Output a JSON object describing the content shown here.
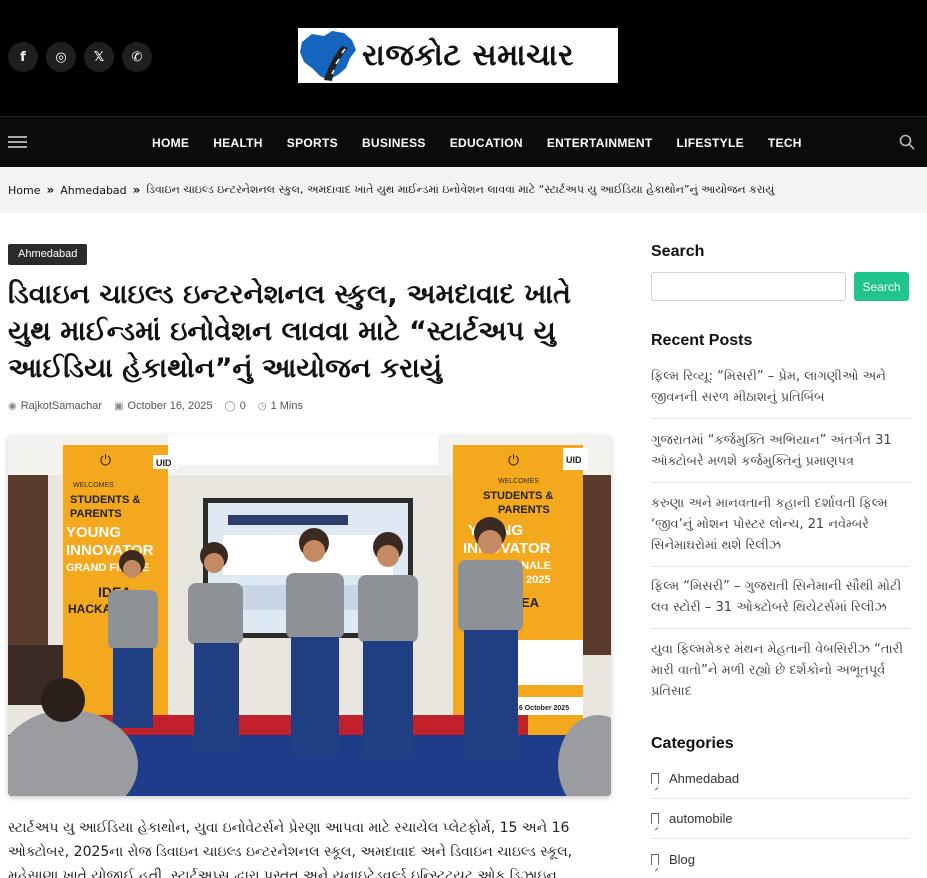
{
  "header": {
    "socials": [
      {
        "icon": "facebook-icon",
        "glyph": "f"
      },
      {
        "icon": "instagram-icon",
        "glyph": "◎"
      },
      {
        "icon": "x-icon",
        "glyph": "𝕏"
      },
      {
        "icon": "whatsapp-icon",
        "glyph": "✆"
      }
    ],
    "logo_text": "રાજકોટ સમાચાર"
  },
  "nav": {
    "items": [
      "HOME",
      "HEALTH",
      "SPORTS",
      "BUSINESS",
      "EDUCATION",
      "ENTERTAINMENT",
      "LIFESTYLE",
      "TECH"
    ]
  },
  "breadcrumb": {
    "home": "Home",
    "category": "Ahmedabad",
    "current": "ડિવાઇન ચાઇલ્ડ ઇન્ટરનેશનલ સ્કુલ, અમદાવાદ ખાતે યુથ માઈન્ડમાં ઇનોવેશન લાવવા માટે “સ્ટાર્ટઅપ યુ આઈડિયા હેકાથોન”નું આયોજન કરાયું"
  },
  "article": {
    "category": "Ahmedabad",
    "title": "ડિવાઇન ચાઇલ્ડ ઇન્ટરનેશનલ સ્કુલ, અમદાવાદ ખાતે યુથ માઈન્ડમાં ઇનોવેશન લાવવા માટે “સ્ટાર્ટઅપ યુ આઈડિયા હેકાથોન”નું આયોજન કરાયું",
    "author": "RajkotSamachar",
    "date": "October 16, 2025",
    "comments": "0",
    "read_time": "1 Mins",
    "body": "સ્ટાર્ટઅપ યુ આઈડિયા હેકાથોન, યુવા ઇનોવેટર્સને પ્રેરણા આપવા માટે રચાયેલ પ્લેટફોર્મ, 15 અને 16 ઓક્ટોબર, 2025ના રોજ ડિવાઇન ચાઇલ્ડ ઇન્ટરનેશનલ સ્કૂલ, અમદાવાદ અને ડિવાઇન ચાઇલ્ડ સ્કૂલ, મહેસાણા ખાતે યોજાઈ હતી. સ્ટાર્ટઅપ્સ દ્વારા પ્રસ્તુત અને યુનાઇટેડવર્લ્ડ ઇન્સ્ટિટ્યૂટ ઓફ ડિઝાઇન, કર્ણાવતી"
  },
  "hero_image": {
    "banner_welcomes": "WELCOMES",
    "banner_students": "STUDENTS &",
    "banner_parents": "PARENTS",
    "banner_young": "YOUNG",
    "banner_innovator": "INNOVATOR",
    "banner_grand": "GRAND FINALE",
    "banner_year": "2025",
    "banner_idea": "IDEA",
    "banner_hackathon": "HACKATHON",
    "banner_date": "16 October 2025",
    "uid": "UID"
  },
  "sidebar": {
    "search_title": "Search",
    "search_button": "Search",
    "recent_title": "Recent Posts",
    "recent_posts": [
      "ફિલ્મ રિવ્યૂ: “મિસરી” – પ્રેમ, લાગણીઓ અને જીવનની સરળ મીઠાશનું પ્રતિબિંબ",
      "ગુજરાતમાં “કર્જમુક્તિ અભિયાન” અંતર્ગત 31 ઑક્ટોબરે મળશે કર્જમુક્તિનું પ્રમાણપત્ર",
      "કરુણા અને માનવતાની કહાની દર્શાવતી ફિલ્મ ‘જીવ’નું મોશન પોસ્ટર લોન્ચ, 21 નવેમ્બરે સિનેમાઘરોમાં થશે રિલીઝ",
      "ફિલ્મ “મિસરી” – ગુજરાતી સિનેમાની સૌથી મોટી લવ સ્ટોરી – 31 ઓક્ટોબરે થિયેટર્સમાં રિલીઝ",
      "યુવા ફિલ્મમેકર મંથન મેહતાની વેબસિરીઝ “તારી મારી વાતો”ને મળી રહ્યો છે દર્શકોનો અભૂતપૂર્વ પ્રતિસાદ"
    ],
    "categories_title": "Categories",
    "categories": [
      "Ahmedabad",
      "automobile",
      "Blog"
    ]
  },
  "colors": {
    "accent": "#1fc58b",
    "header_bg": "#000000",
    "crumb_bg": "#f3f3f3"
  }
}
